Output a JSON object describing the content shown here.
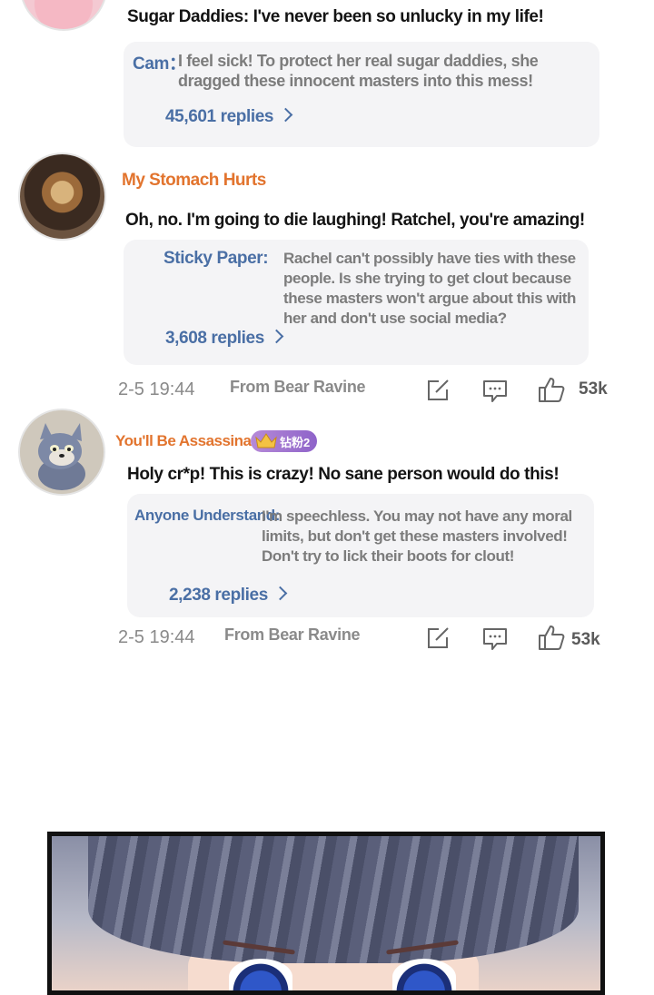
{
  "comments": [
    {
      "body": "Sugar Daddies: I've never been so unlucky in my life!",
      "reply": {
        "name": "Cam：",
        "lines": [
          "I feel sick! To protect her real sugar daddies, she",
          "dragged these innocent masters into this mess!"
        ],
        "count": "45,601 replies"
      }
    },
    {
      "username": "My Stomach Hurts",
      "body": "Oh, no. I'm going to die laughing! Ratchel, you're amazing!",
      "reply": {
        "name": "Sticky Paper:",
        "lines": [
          "Rachel can't possibly have ties with these",
          "people. Is she trying to get clout because",
          "these masters won't argue about this with",
          "her and don't use social media?"
        ],
        "count": "3,608 replies"
      },
      "time": "2-5 19:44",
      "from": "From Bear Ravine",
      "likes": "53k"
    },
    {
      "username": "You'll Be Assassinated,",
      "badge": "钻粉2",
      "body": "Holy cr*p! This is crazy! No sane person would do this!",
      "reply": {
        "name": "Anyone Understand:",
        "lines": [
          "I'm speechless. You may not have any moral",
          "limits, but don't get these masters involved!",
          "Don't try to lick their boots for clout!"
        ],
        "count": "2,238 replies"
      },
      "time": "2-5 19:44",
      "from": "From Bear Ravine",
      "likes": "53k"
    }
  ],
  "icons": [
    "edit-icon",
    "comment-icon",
    "like-icon",
    "crown-icon",
    "chevron-right-icon"
  ],
  "colors": {
    "username": "#e2742e",
    "reply_name": "#4a6fa5",
    "reply_bg": "#f4f4f6",
    "badge": "#9b72cf"
  }
}
